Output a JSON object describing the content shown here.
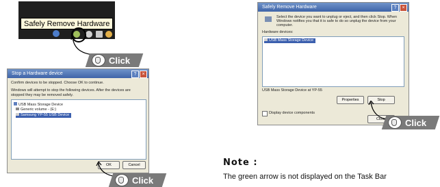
{
  "tooltip": "Safely Remove Hardware",
  "click_label": "Click",
  "stop_dialog": {
    "title": "Stop a Hardware device",
    "confirm_text": "Confirm devices to be stopped. Choose OK to continue.",
    "info_text_1": "Windows will attempt to stop the following devices. After the devices are",
    "info_text_2": "stopped they may be removed safely.",
    "devices": [
      "USB Mass Storage Device",
      "Generic volume - (E:)",
      "Samsung YP-55 USB Device"
    ],
    "ok": "OK",
    "cancel": "Cancel"
  },
  "safe_dialog": {
    "title": "Safely Remove Hardware",
    "intro_1": "Select the device you want to unplug or eject, and then click Stop. When",
    "intro_2": "Windows notifies you that it is safe to do so unplug the device from your",
    "intro_3": "computer.",
    "hardware_label": "Hardware devices:",
    "selected_device": "USB Mass Storage Device",
    "device_status": "USB Mass Storage Device at YP-55",
    "properties": "Properties",
    "stop": "Stop",
    "display_components": "Display device components",
    "close": "Close"
  },
  "note": {
    "title": "Note :",
    "text": "The green arrow is not displayed on the Task Bar"
  }
}
